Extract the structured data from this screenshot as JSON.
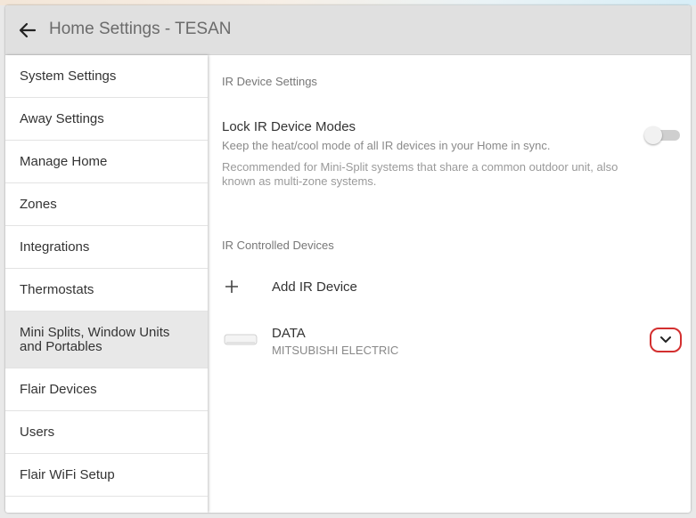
{
  "header": {
    "title": "Home Settings - TESAN"
  },
  "sidebar": {
    "items": [
      {
        "label": "System Settings"
      },
      {
        "label": "Away Settings"
      },
      {
        "label": "Manage Home"
      },
      {
        "label": "Zones"
      },
      {
        "label": "Integrations"
      },
      {
        "label": "Thermostats"
      },
      {
        "label": "Mini Splits, Window Units and Portables",
        "active": true
      },
      {
        "label": "Flair Devices"
      },
      {
        "label": "Users"
      },
      {
        "label": "Flair WiFi Setup"
      }
    ]
  },
  "main": {
    "ir_settings_label": "IR Device Settings",
    "lock_modes": {
      "title": "Lock IR Device Modes",
      "description": "Keep the heat/cool mode of all IR devices in your Home in sync.",
      "note": "Recommended for Mini-Split systems that share a common outdoor unit, also known as multi-zone systems.",
      "enabled": false
    },
    "ir_devices_label": "IR Controlled Devices",
    "add_device_label": "Add IR Device",
    "devices": [
      {
        "name": "DATA",
        "brand": "MITSUBISHI ELECTRIC",
        "icon": "mini-split-icon"
      }
    ]
  },
  "colors": {
    "header_bg": "#e0e0e0",
    "active_item_bg": "#e8e8e8",
    "highlight_ring": "#d32f2f"
  }
}
